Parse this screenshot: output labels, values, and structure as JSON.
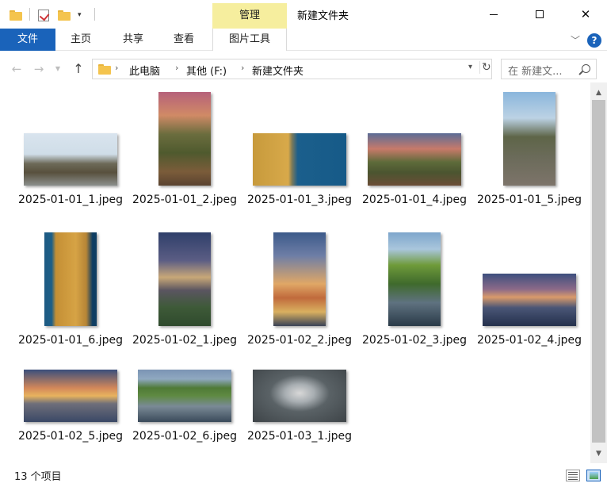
{
  "window": {
    "title": "新建文件夹",
    "contextual_tab_group": "管理"
  },
  "ribbon": {
    "tabs": [
      "文件",
      "主页",
      "共享",
      "查看",
      "图片工具"
    ],
    "help_label": "?"
  },
  "nav": {
    "breadcrumb": [
      "此电脑",
      "其他 (F:)",
      "新建文件夹"
    ],
    "search_placeholder": "在 新建文..."
  },
  "files": [
    {
      "name": "2025-01-01_1.jpeg"
    },
    {
      "name": "2025-01-01_2.jpeg"
    },
    {
      "name": "2025-01-01_3.jpeg"
    },
    {
      "name": "2025-01-01_4.jpeg"
    },
    {
      "name": "2025-01-01_5.jpeg"
    },
    {
      "name": "2025-01-01_6.jpeg"
    },
    {
      "name": "2025-01-02_1.jpeg"
    },
    {
      "name": "2025-01-02_2.jpeg"
    },
    {
      "name": "2025-01-02_3.jpeg"
    },
    {
      "name": "2025-01-02_4.jpeg"
    },
    {
      "name": "2025-01-02_5.jpeg"
    },
    {
      "name": "2025-01-02_6.jpeg"
    },
    {
      "name": "2025-01-03_1.jpeg"
    }
  ],
  "status": {
    "item_count": "13 个项目"
  }
}
